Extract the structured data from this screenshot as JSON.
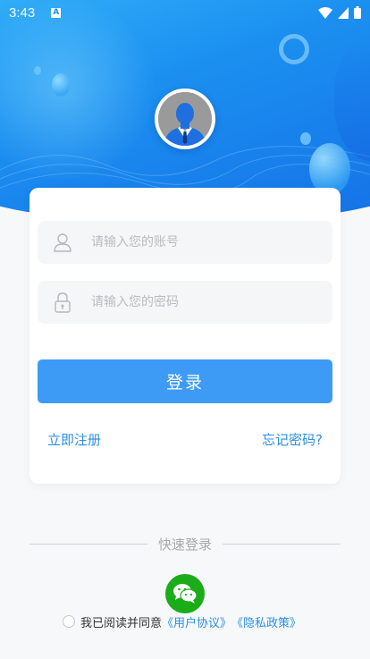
{
  "status_bar": {
    "time": "3:43",
    "notification_icon": "A"
  },
  "login": {
    "account_placeholder": "请输入您的账号",
    "password_placeholder": "请输入您的密码",
    "login_label": "登录",
    "register_label": "立即注册",
    "forgot_label": "忘记密码?"
  },
  "quick_login": {
    "title": "快速登录"
  },
  "agreement": {
    "prefix": "我已阅读并同意",
    "user_agreement": "《用户协议》",
    "privacy_policy": "《隐私政策》",
    "checked": false
  },
  "colors": {
    "accent": "#3d9bf5",
    "link": "#2b8fe6",
    "wechat": "#1aad19"
  },
  "icons": {
    "account_field": "user-icon",
    "password_field": "lock-icon",
    "quick_login": "wechat-icon"
  }
}
